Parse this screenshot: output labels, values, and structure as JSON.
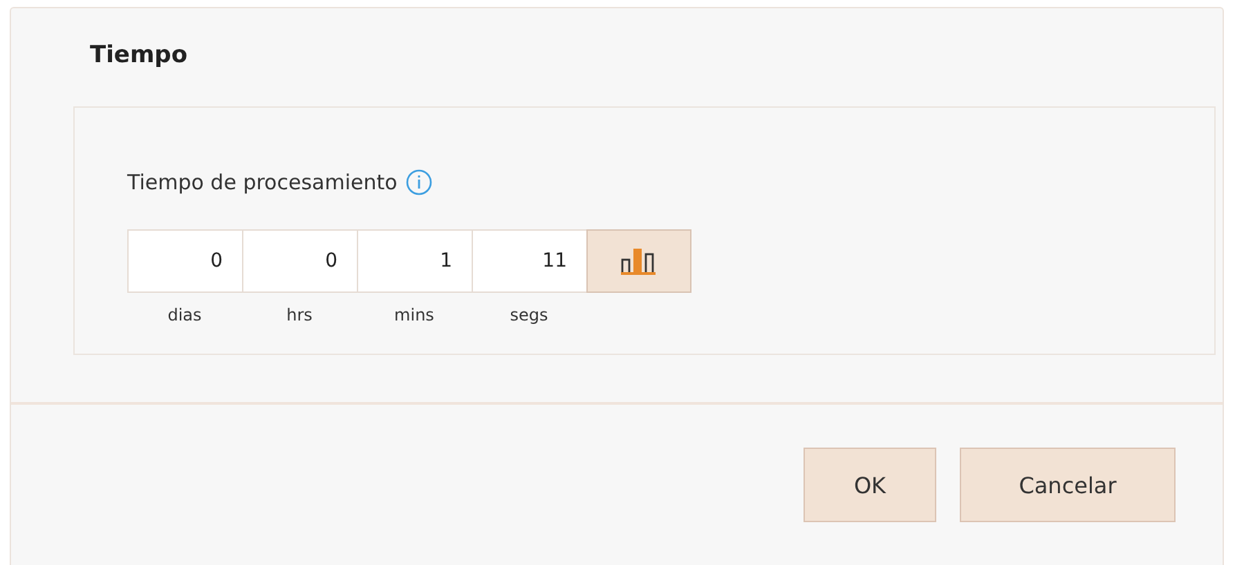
{
  "section": {
    "title": "Tiempo"
  },
  "field": {
    "label": "Tiempo de procesamiento"
  },
  "parts": [
    {
      "value": "0",
      "unit": "dias"
    },
    {
      "value": "0",
      "unit": "hrs"
    },
    {
      "value": "1",
      "unit": "mins"
    },
    {
      "value": "11",
      "unit": "segs"
    }
  ],
  "buttons": [
    "OK",
    "Cancelar"
  ]
}
